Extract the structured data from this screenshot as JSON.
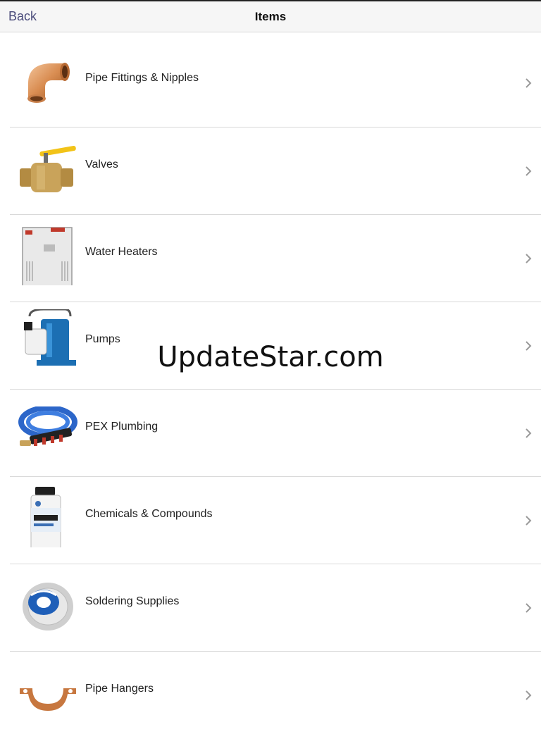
{
  "header": {
    "back_label": "Back",
    "title": "Items"
  },
  "items": [
    {
      "label": "Pipe Fittings & Nipples",
      "icon": "pipe-elbow-icon"
    },
    {
      "label": "Valves",
      "icon": "ball-valve-icon"
    },
    {
      "label": "Water Heaters",
      "icon": "water-heater-icon"
    },
    {
      "label": "Pumps",
      "icon": "pump-icon"
    },
    {
      "label": "PEX Plumbing",
      "icon": "pex-tubing-icon"
    },
    {
      "label": "Chemicals & Compounds",
      "icon": "chemical-bottle-icon"
    },
    {
      "label": "Soldering Supplies",
      "icon": "solder-spool-icon"
    },
    {
      "label": "Pipe Hangers",
      "icon": "pipe-hanger-icon"
    }
  ],
  "watermark": "UpdateStar.com",
  "colors": {
    "back_link": "#4a4b7a",
    "header_bg": "#f6f6f6",
    "divider": "#d9d9d9",
    "chevron": "#9a9a9a"
  }
}
